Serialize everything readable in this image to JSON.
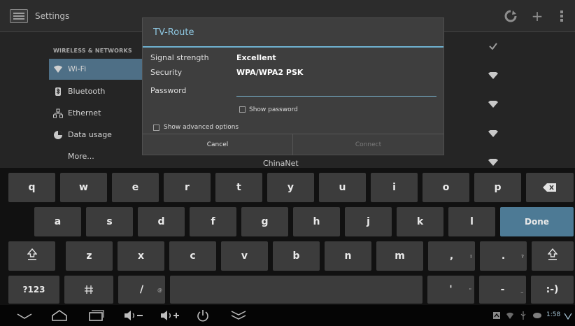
{
  "action_bar": {
    "title": "Settings",
    "icons": [
      "settings-app-icon",
      "refresh-icon",
      "add-icon",
      "overflow-menu-icon"
    ]
  },
  "settings": {
    "section_header": "WIRELESS & NETWORKS",
    "items": [
      {
        "label": "Wi-Fi",
        "icon": "wifi-icon"
      },
      {
        "label": "Bluetooth",
        "icon": "bluetooth-icon"
      },
      {
        "label": "Ethernet",
        "icon": "ethernet-icon"
      },
      {
        "label": "Data usage",
        "icon": "data-usage-icon"
      },
      {
        "label": "More..."
      }
    ]
  },
  "dialog": {
    "title": "TV-Route",
    "signal_label": "Signal strength",
    "signal_value": "Excellent",
    "security_label": "Security",
    "security_value": "WPA/WPA2 PSK",
    "password_label": "Password",
    "password_value": "",
    "show_password": "Show password",
    "show_advanced": "Show advanced options",
    "cancel": "Cancel",
    "connect": "Connect"
  },
  "network_below_dialog": "ChinaNet",
  "keyboard": {
    "row1": [
      "q",
      "w",
      "e",
      "r",
      "t",
      "y",
      "u",
      "i",
      "o",
      "p"
    ],
    "row2": [
      "a",
      "s",
      "d",
      "f",
      "g",
      "h",
      "j",
      "k",
      "l"
    ],
    "row3": [
      "z",
      "x",
      "c",
      "v",
      "b",
      "n",
      "m"
    ],
    "done": "Done",
    "mode_key": "?123",
    "emoji_key": ":-)",
    "slash_key": "/",
    "slash_hint": "@",
    "comma_key": ",",
    "comma_hint": "!",
    "period_key": ".",
    "period_hint": "?",
    "apostrophe_key": "'",
    "apostrophe_hint": "\"",
    "dash_key": "-",
    "dash_hint": "_"
  },
  "system_bar": {
    "time": "1:58",
    "nav_icons": [
      "hide-keyboard-icon",
      "home-icon",
      "recent-apps-icon",
      "volume-down-icon",
      "volume-up-icon",
      "power-icon",
      "collapse-icon"
    ]
  },
  "colors": {
    "accent": "#6fb0cf",
    "selected_item": "#4e6f86",
    "done_key": "#4d7a95"
  }
}
